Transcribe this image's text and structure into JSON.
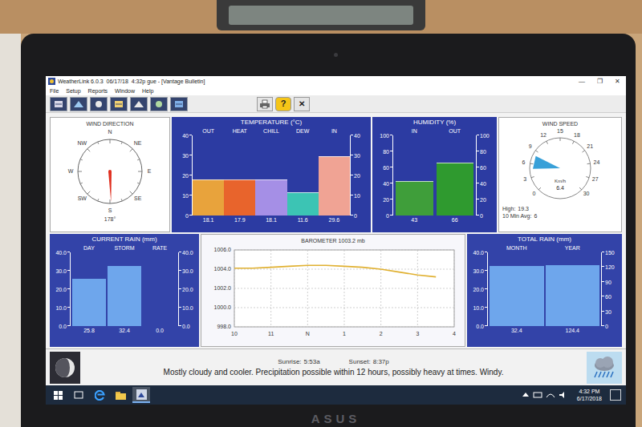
{
  "window": {
    "title": "WeatherLink 6.0.3  06/17/18  4:32p gue - [Vantage Bulletin]",
    "controls": [
      "—",
      "❐",
      "✕"
    ]
  },
  "menu": [
    "File",
    "Setup",
    "Reports",
    "Window",
    "Help"
  ],
  "toolbar": {
    "help": "?",
    "close": "✕"
  },
  "wind_direction": {
    "title": "WIND DIRECTION",
    "points": [
      "N",
      "NE",
      "E",
      "SE",
      "S",
      "SW",
      "W",
      "NW"
    ],
    "degrees": 178,
    "reading": "178°"
  },
  "temperature": {
    "title": "TEMPERATURE (°C)",
    "ticks": [
      "0",
      "10",
      "20",
      "30",
      "40"
    ],
    "bars": [
      {
        "label": "OUT",
        "value": 18.1,
        "reading": "18.1",
        "color": "#e8a33c"
      },
      {
        "label": "HEAT",
        "value": 17.9,
        "reading": "17.9",
        "color": "#e8642c"
      },
      {
        "label": "CHILL",
        "value": 18.1,
        "reading": "18.1",
        "color": "#a58fe6"
      },
      {
        "label": "DEW",
        "value": 11.6,
        "reading": "11.6",
        "color": "#3cc4b4"
      },
      {
        "label": "IN",
        "value": 29.6,
        "reading": "29.6",
        "color": "#f0a394"
      }
    ]
  },
  "humidity": {
    "title": "HUMIDITY (%)",
    "ticks": [
      "0",
      "20",
      "40",
      "60",
      "80",
      "100"
    ],
    "bars": [
      {
        "label": "IN",
        "value": 43,
        "reading": "43",
        "color": "#3f9e3a"
      },
      {
        "label": "OUT",
        "value": 66,
        "reading": "66",
        "color": "#2f9a2f"
      }
    ]
  },
  "wind_speed": {
    "title": "WIND SPEED",
    "ticks": [
      "0",
      "3",
      "6",
      "9",
      "12",
      "15",
      "18",
      "21",
      "24",
      "27",
      "30"
    ],
    "value": 6.4,
    "unit": "Km/h",
    "reading": "6.4",
    "high_label": "High:",
    "high": "19.3",
    "avg_label": "10 Min Avg:",
    "avg": "6"
  },
  "current_rain": {
    "title": "CURRENT RAIN (mm)",
    "ticks": [
      "0.0",
      "10.0",
      "20.0",
      "30.0",
      "40.0"
    ],
    "bars": [
      {
        "label": "DAY",
        "value": 25.8,
        "reading": "25.8"
      },
      {
        "label": "STORM",
        "value": 32.4,
        "reading": "32.4"
      },
      {
        "label": "RATE",
        "value": 0,
        "reading": "0.0"
      }
    ]
  },
  "barometer": {
    "title": "BAROMETER 1003.2 mb",
    "y_ticks": [
      "998.0",
      "1000.0",
      "1002.0",
      "1004.0",
      "1006.0"
    ],
    "x_ticks": [
      "10",
      "11",
      "N",
      "1",
      "2",
      "3",
      "4"
    ],
    "values": [
      1004.1,
      1004.1,
      1004.2,
      1004.3,
      1004.4,
      1004.4,
      1004.3,
      1004.2,
      1004.0,
      1003.7,
      1003.4,
      1003.2
    ]
  },
  "total_rain": {
    "title": "TOTAL RAIN (mm)",
    "ticks_left": [
      "0.0",
      "10.0",
      "20.0",
      "30.0",
      "40.0"
    ],
    "ticks_right": [
      "0",
      "30",
      "60",
      "90",
      "120",
      "150"
    ],
    "bars": [
      {
        "label": "MONTH",
        "value": 32.4,
        "reading": "32.4",
        "axis": "left"
      },
      {
        "label": "YEAR",
        "value": 124.4,
        "reading": "124.4",
        "axis": "right"
      }
    ]
  },
  "forecast": {
    "sunrise_label": "Sunrise:",
    "sunrise": "5:53a",
    "sunset_label": "Sunset:",
    "sunset": "8:37p",
    "text": "Mostly cloudy and cooler. Precipitation possible within 12 hours, possibly heavy at times. Windy."
  },
  "taskbar": {
    "time": "4:32 PM",
    "date": "6/17/2018"
  },
  "laptop": {
    "brand": "ASUS"
  }
}
